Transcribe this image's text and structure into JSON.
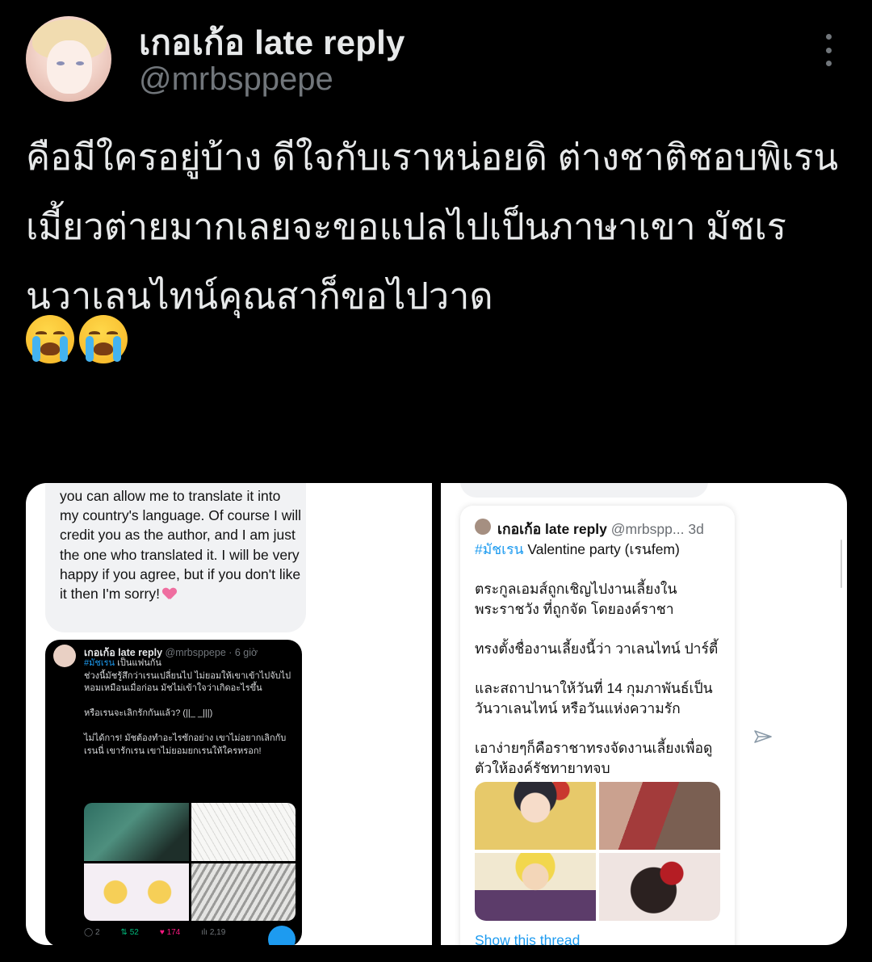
{
  "tweet": {
    "display_name": "เกอเก้อ late reply",
    "handle": "@mrbsppepe",
    "text": "คือมีใครอยู่บ้าง ดีใจกับเราหน่อยดิ ต่างชาติชอบพิเรนเมี้ยวต่ายมากเลยจะขอแปลไปเป็นภาษาเขา มัชเรนวาเลนไทน์คุณสาก็ขอไปวาด",
    "emojis": [
      "loudly-crying-face-icon",
      "loudly-crying-face-icon"
    ]
  },
  "left_panel": {
    "message": "you can allow me to translate it into my country's language. Of course I will credit you as the author, and I am just the one who translated it. I will be very happy if you agree, but if you don't like it then I'm sorry!",
    "embedded_tweet": {
      "name": "เกอเก้อ late reply",
      "handle_time": "@mrbsppepe · 6 giờ",
      "hashtag": "#มัชเรน",
      "line1": " เป็นแฟนกัน",
      "body1": "ช่วงนี้มัชรู้สึกว่าเรนเปลี่ยนไป ไม่ยอมให้เขาเข้าไปจับไปหอมเหมือนเมื่อก่อน มัชไม่เข้าใจว่าเกิดอะไรขึ้น",
      "body2": "หรือเรนจะเลิกรักกันแล้ว? (||_ _|||)",
      "body3": "ไม่ได้การ! มัชต้องทำอะไรซักอย่าง เขาไม่อยากเลิกกับเรนนี่ เขารักเรน เขาไม่ยอมยกเรนให้ใครหรอก!",
      "replies": "2",
      "retweets": "52",
      "likes": "174",
      "views": "2,19"
    }
  },
  "right_panel": {
    "embedded_tweet": {
      "name": "เกอเก้อ late reply",
      "handle": "@mrbspp...",
      "time": "3d",
      "hashtag": "#มัชเรน",
      "line1": " Valentine party (เรนfem)",
      "p1": "ตระกูลเอมส์ถูกเชิญไปงานเลี้ยงใน พระราชวัง ที่ถูกจัด โดยองค์ราชา",
      "p2": "ทรงตั้งชื่องานเลี้ยงนี้ว่า วาเลนไทน์ ปาร์ตี้",
      "p3": "และสถาปานาให้วันที่ 14 กุมภาพันธ์เป็นวันวาเลนไทน์ หรือวันแห่งความรัก",
      "p4": "เอาง่ายๆก็คือราชาทรงจัดงานเลี้ยงเพื่อดูตัวให้องค์รัชทายาทจบ",
      "show_thread": "Show this thread"
    }
  },
  "colors": {
    "background": "#000000",
    "text_primary": "#e7e9ea",
    "text_secondary": "#71767b",
    "link": "#1d9bf0"
  }
}
